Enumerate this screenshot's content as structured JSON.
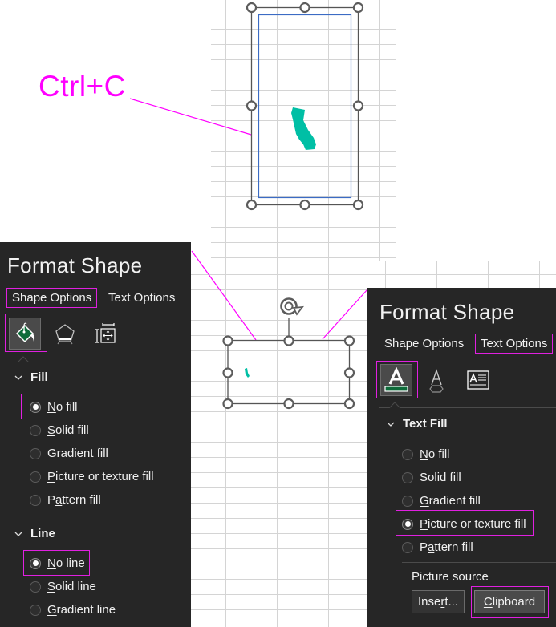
{
  "callout": {
    "label": "Ctrl+C",
    "color": "#ff00ff"
  },
  "shapes": {
    "top_shape": {
      "name": "California map shape (selected)",
      "fill_color": "#00bfa5"
    },
    "bottom_shape": {
      "name": "Text box with California fill (selected)"
    }
  },
  "panel_left": {
    "title": "Format Shape",
    "tabs": [
      {
        "label": "Shape Options",
        "active": true,
        "highlighted": true
      },
      {
        "label": "Text Options",
        "active": false,
        "highlighted": false
      }
    ],
    "icon_tabs": [
      {
        "icon": "fill-line-icon",
        "active": true
      },
      {
        "icon": "effects-icon",
        "active": false
      },
      {
        "icon": "size-properties-icon",
        "active": false
      }
    ],
    "sections": [
      {
        "header": "Fill",
        "expanded": true,
        "options": [
          {
            "pre": "",
            "key": "N",
            "post": "o fill",
            "selected": true,
            "highlighted": true
          },
          {
            "pre": "",
            "key": "S",
            "post": "olid fill",
            "selected": false
          },
          {
            "pre": "",
            "key": "G",
            "post": "radient fill",
            "selected": false
          },
          {
            "pre": "",
            "key": "P",
            "post": "icture or texture fill",
            "selected": false
          },
          {
            "pre": "P",
            "key": "a",
            "post": "ttern fill",
            "selected": false
          }
        ]
      },
      {
        "header": "Line",
        "expanded": true,
        "options": [
          {
            "pre": "",
            "key": "N",
            "post": "o line",
            "selected": true,
            "highlighted": true
          },
          {
            "pre": "",
            "key": "S",
            "post": "olid line",
            "selected": false
          },
          {
            "pre": "",
            "key": "G",
            "post": "radient line",
            "selected": false
          }
        ]
      }
    ]
  },
  "panel_right": {
    "title": "Format Shape",
    "tabs": [
      {
        "label": "Shape Options",
        "active": false,
        "highlighted": false
      },
      {
        "label": "Text Options",
        "active": true,
        "highlighted": true
      }
    ],
    "icon_tabs": [
      {
        "icon": "text-fill-outline-icon",
        "active": true
      },
      {
        "icon": "text-effects-icon",
        "active": false
      },
      {
        "icon": "text-box-icon",
        "active": false
      }
    ],
    "section": {
      "header": "Text Fill",
      "expanded": true,
      "options": [
        {
          "pre": "",
          "key": "N",
          "post": "o fill",
          "selected": false
        },
        {
          "pre": "",
          "key": "S",
          "post": "olid fill",
          "selected": false
        },
        {
          "pre": "",
          "key": "G",
          "post": "radient fill",
          "selected": false
        },
        {
          "pre": "",
          "key": "P",
          "post": "icture or texture fill",
          "selected": true,
          "highlighted": true
        },
        {
          "pre": "P",
          "key": "a",
          "post": "ttern fill",
          "selected": false
        }
      ]
    },
    "picture_source": {
      "label": "Picture source",
      "insert": {
        "pre": "Inse",
        "key": "r",
        "post": "t..."
      },
      "clipboard": {
        "pre": "",
        "key": "C",
        "post": "lipboard",
        "highlighted": true
      }
    }
  },
  "colors": {
    "panel_bg": "#262626",
    "highlight": "#e020e0",
    "fill_icon_green": "#0e6b3a",
    "shape_teal": "#00bfa5",
    "inner_border_blue": "#3b6bc4"
  }
}
